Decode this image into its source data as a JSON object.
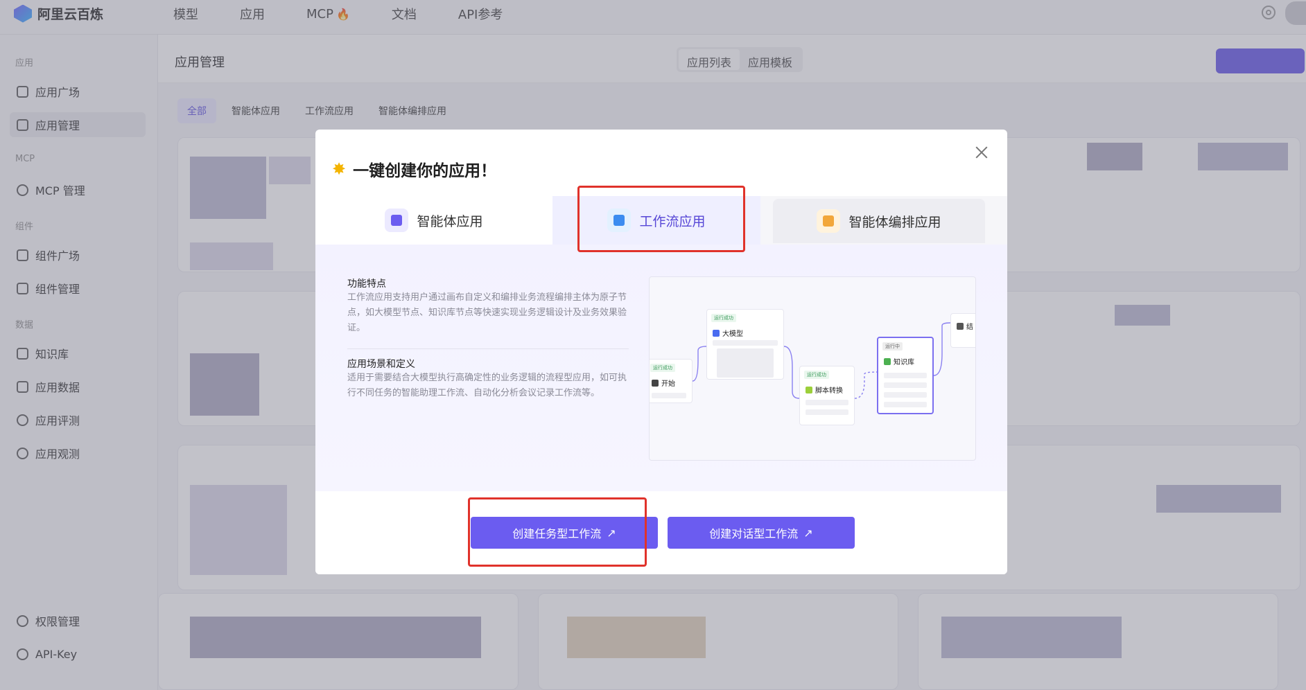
{
  "brand": {
    "name": "阿里云百炼"
  },
  "nav": {
    "items": [
      "模型",
      "应用",
      "MCP",
      "文档",
      "API参考"
    ],
    "mcp_badge": "🔥"
  },
  "sidebar": {
    "groups": {
      "app": "应用",
      "mcp": "MCP",
      "component": "组件",
      "data": "数据"
    },
    "items": [
      "应用广场",
      "应用管理",
      "MCP 管理",
      "组件广场",
      "组件管理",
      "知识库",
      "应用数据",
      "应用评测",
      "应用观测",
      "权限管理",
      "API-Key"
    ]
  },
  "page": {
    "title": "应用管理",
    "segments": [
      "应用列表",
      "应用模板"
    ],
    "filters": [
      "全部",
      "智能体应用",
      "工作流应用",
      "智能体编排应用"
    ]
  },
  "modal": {
    "title": "一键创建你的应用！",
    "tabs": [
      "智能体应用",
      "工作流应用",
      "智能体编排应用"
    ],
    "active_tab": "工作流应用",
    "features_title": "功能特点",
    "features_body": "工作流应用支持用户通过画布自定义和编排业务流程编排主体为原子节点，如大模型节点、知识库节点等快速实现业务逻辑设计及业务效果验证。",
    "scenario_title": "应用场景和定义",
    "scenario_body": "适用于需要结合大模型执行高确定性的业务逻辑的流程型应用，如可执行不同任务的智能助理工作流、自动化分析会议记录工作流等。",
    "preview": {
      "status_success": "运行成功",
      "status_running": "运行中",
      "start": "开始",
      "llm": "大模型",
      "script": "脚本转换",
      "kb": "知识库",
      "end": "结"
    },
    "btn_task": "创建任务型工作流",
    "btn_chat": "创建对话型工作流"
  },
  "colors": {
    "accent": "#6b5cf0",
    "highlight": "#e0322b"
  }
}
